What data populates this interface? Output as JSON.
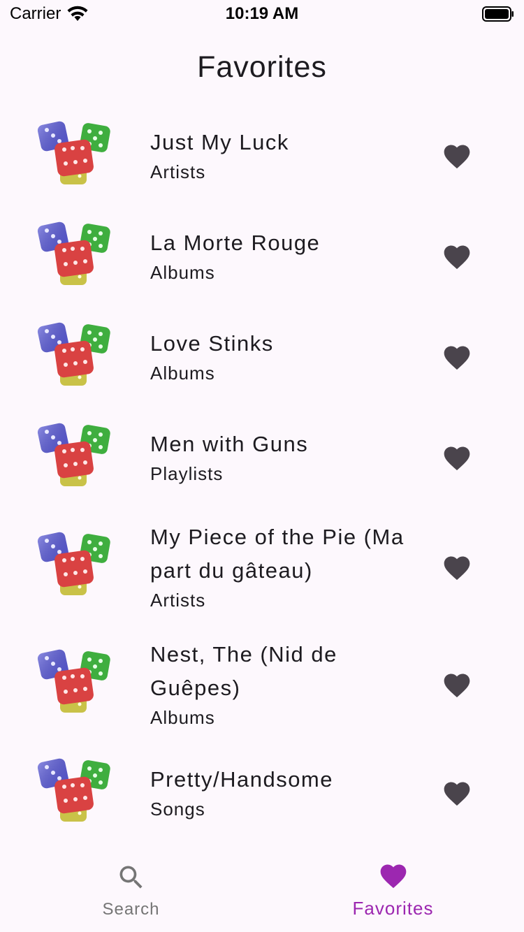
{
  "status_bar": {
    "carrier": "Carrier",
    "time": "10:19 AM"
  },
  "page": {
    "title": "Favorites"
  },
  "favorites": [
    {
      "title": "Just My Luck",
      "category": "Artists"
    },
    {
      "title": "La Morte Rouge",
      "category": "Albums"
    },
    {
      "title": "Love Stinks",
      "category": "Albums"
    },
    {
      "title": "Men with Guns",
      "category": "Playlists"
    },
    {
      "title": "My Piece of the Pie (Ma part du gâteau)",
      "category": "Artists"
    },
    {
      "title": "Nest, The (Nid de Guêpes)",
      "category": "Albums"
    },
    {
      "title": "Pretty/Handsome",
      "category": "Songs"
    }
  ],
  "bottom_nav": {
    "search": {
      "label": "Search",
      "icon": "search-icon"
    },
    "favorites": {
      "label": "Favorites",
      "icon": "heart-icon",
      "active": true
    }
  },
  "colors": {
    "background": "#fdf8fd",
    "text": "#1d1b20",
    "heart": "#4a444c",
    "accent": "#9c27b0",
    "inactive": "#757575"
  }
}
